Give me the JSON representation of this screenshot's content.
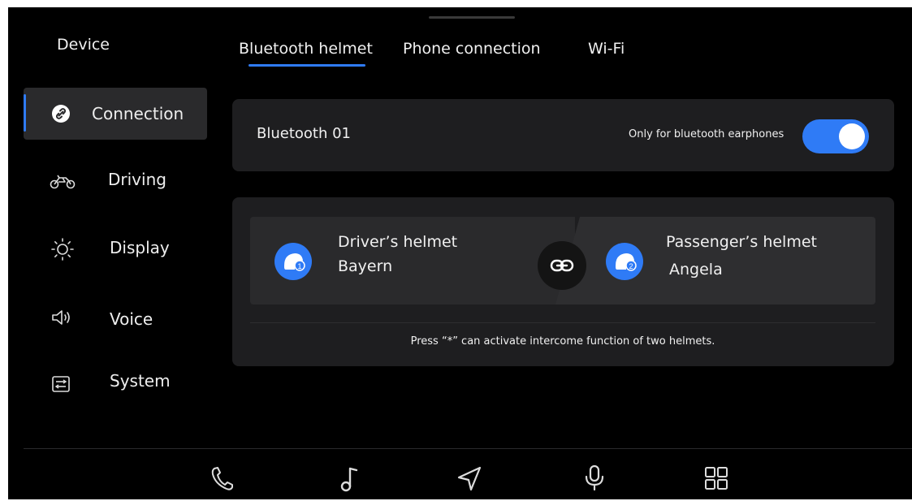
{
  "sidebar": {
    "title": "Device",
    "items": [
      {
        "label": "Connection",
        "icon": "link-icon",
        "active": true
      },
      {
        "label": "Driving",
        "icon": "motorcycle-icon"
      },
      {
        "label": "Display",
        "icon": "sun-icon"
      },
      {
        "label": "Voice",
        "icon": "speaker-icon"
      },
      {
        "label": "System",
        "icon": "system-icon"
      }
    ]
  },
  "tabs": [
    {
      "label": "Bluetooth helmet",
      "active": true
    },
    {
      "label": "Phone connection"
    },
    {
      "label": "Wi-Fi"
    }
  ],
  "bluetooth": {
    "name": "Bluetooth 01",
    "toggle_label": "Only for bluetooth earphones",
    "toggle_on": true
  },
  "helmets": {
    "driver": {
      "title": "Driver’s helmet",
      "name": "Bayern",
      "badge": "1"
    },
    "passenger": {
      "title": "Passenger’s helmet",
      "name": "Angela",
      "badge": "2"
    },
    "hint": "Press “*” can activate intercome function of two helmets."
  },
  "dock": [
    "phone-icon",
    "music-note-icon",
    "navigation-icon",
    "microphone-icon",
    "apps-grid-icon"
  ],
  "colors": {
    "accent": "#2f7bf6",
    "background": "#000000",
    "card": "#1e1e20"
  }
}
